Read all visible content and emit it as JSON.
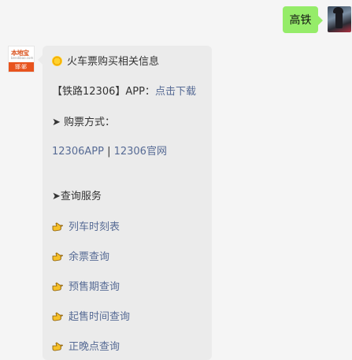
{
  "user_message": {
    "text": "高铁"
  },
  "bot_avatar": {
    "brand": "本地宝",
    "url": "bendibao.com",
    "city": "邯郸"
  },
  "bot_message": {
    "header": "火车票购买相关信息",
    "app_prefix": "【铁路12306】APP：",
    "app_link": "点击下载",
    "purchase_arrow": "➤",
    "purchase_label": "购票方式：",
    "purchase_links": [
      "12306APP",
      "12306官网"
    ],
    "purchase_separator": " | ",
    "query_arrow": "➤",
    "query_label": "查询服务",
    "services": [
      "列车时刻表",
      "余票查询",
      "预售期查询",
      "起售时间查询",
      "正晚点查询"
    ]
  },
  "icons": {
    "header": "sun-icon",
    "service": "pointing-hand-icon",
    "arrow": "arrow-icon"
  }
}
